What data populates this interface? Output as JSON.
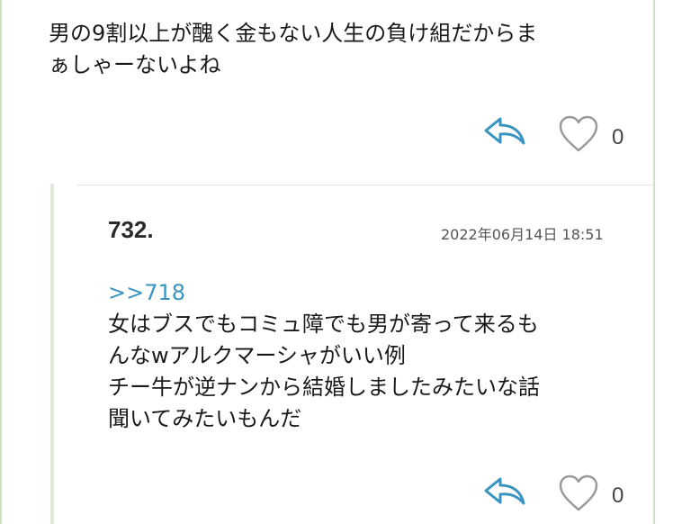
{
  "post_top": {
    "text_lines": [
      "男の9割以上が醜く金もない人生の負け組だからま",
      "ぁしゃーないよね"
    ],
    "like_count": "0",
    "reply_icon": "reply-arrow-icon",
    "like_icon": "heart-outline-icon"
  },
  "reply": {
    "number": "732.",
    "timestamp": "2022年06月14日 18:51",
    "anchor_link": ">>718",
    "body_lines": [
      "女はブスでもコミュ障でも男が寄って来るも",
      "んなwアルクマーシャがいい例",
      "チー牛が逆ナンから結婚しましたみたいな話",
      "聞いてみたいもんだ"
    ],
    "like_count": "0",
    "reply_icon": "reply-arrow-icon",
    "like_icon": "heart-outline-icon"
  },
  "colors": {
    "accent_blue": "#3a94c0",
    "rail_green": "#cfe3c2",
    "icon_gray": "#999999"
  }
}
